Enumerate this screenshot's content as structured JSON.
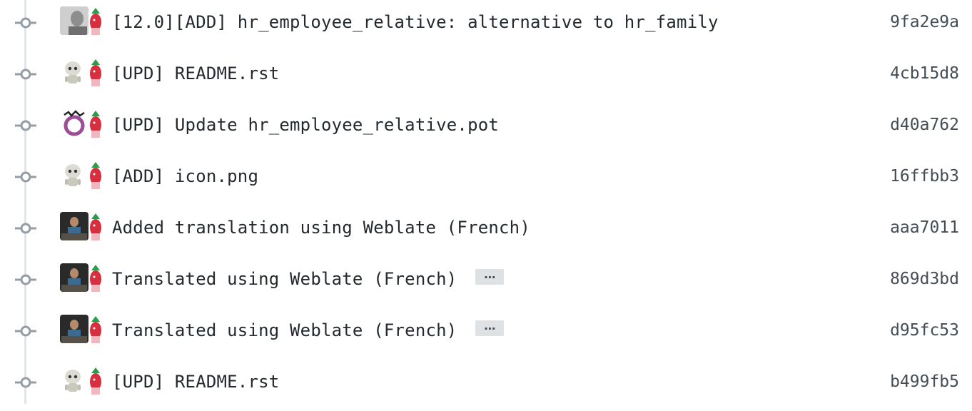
{
  "commits": [
    {
      "message": "[12.0][ADD] hr_employee_relative: alternative to hr_family",
      "sha": "9fa2e9a",
      "avatar": "avatar-photo-gray",
      "has_more": false
    },
    {
      "message": "[UPD] README.rst",
      "sha": "4cb15d8",
      "avatar": "avatar-robot",
      "has_more": false
    },
    {
      "message": "[UPD] Update hr_employee_relative.pot",
      "sha": "d40a762",
      "avatar": "avatar-ring",
      "has_more": false
    },
    {
      "message": "[ADD] icon.png",
      "sha": "16ffbb3",
      "avatar": "avatar-robot",
      "has_more": false
    },
    {
      "message": "Added translation using Weblate (French)",
      "sha": "aaa7011",
      "avatar": "avatar-photo-dark",
      "has_more": false
    },
    {
      "message": "Translated using Weblate (French)",
      "sha": "869d3bd",
      "avatar": "avatar-photo-dark",
      "has_more": true,
      "more_label": "…"
    },
    {
      "message": "Translated using Weblate (French)",
      "sha": "d95fc53",
      "avatar": "avatar-photo-dark",
      "has_more": true,
      "more_label": "…"
    },
    {
      "message": "[UPD] README.rst",
      "sha": "b499fb5",
      "avatar": "avatar-robot",
      "has_more": false
    }
  ],
  "colors": {
    "text": "#24292e",
    "sha": "#444d56",
    "timeline": "#e1e4e8",
    "node": "#959da5",
    "ellipsis_bg": "#dfe2e5"
  },
  "icons": {
    "commit_node": "git-commit-icon",
    "coauthor_avatar": "avatar-red-cartoon"
  }
}
